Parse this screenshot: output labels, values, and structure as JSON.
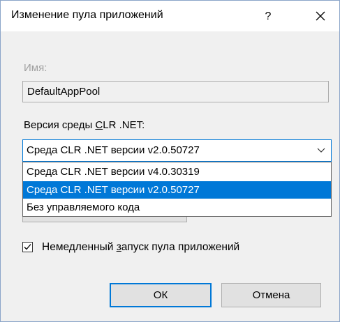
{
  "window": {
    "title": "Изменение пула приложений",
    "help_label": "?"
  },
  "name_field": {
    "label": "Имя:",
    "value": "DefaultAppPool"
  },
  "clr_version": {
    "label_pre": "Версия среды ",
    "label_accel": "C",
    "label_post": "LR .NET:",
    "selected": "Среда CLR .NET версии v2.0.50727",
    "options": [
      "Среда CLR .NET версии v4.0.30319",
      "Среда CLR .NET версии v2.0.50727",
      "Без управляемого кода"
    ],
    "highlighted_index": 1
  },
  "start_immediately": {
    "label_pre": "Немедленный ",
    "label_accel": "з",
    "label_post": "апуск пула приложений",
    "checked": true
  },
  "buttons": {
    "ok": "ОК",
    "cancel": "Отмена"
  },
  "colors": {
    "accent": "#0078d7",
    "dialog_bg": "#f0f0f0",
    "disabled_text": "#a0a0a0"
  }
}
